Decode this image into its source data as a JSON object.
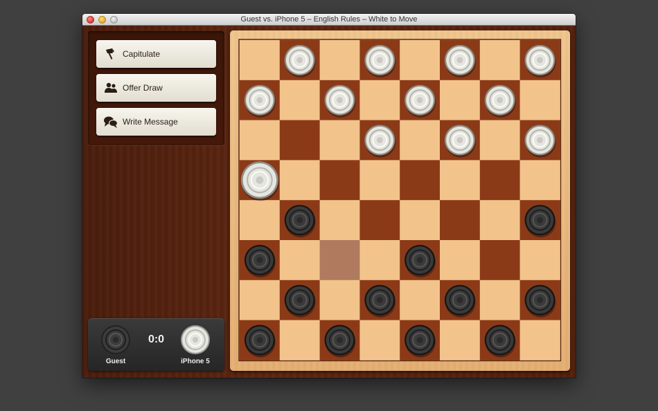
{
  "window": {
    "title": "Guest vs. iPhone 5 – English Rules – White to Move"
  },
  "actions": [
    {
      "label": "Capitulate",
      "icon": "flag-icon"
    },
    {
      "label": "Offer Draw",
      "icon": "handshake-icon"
    },
    {
      "label": "Write Message",
      "icon": "chat-bubbles-icon"
    }
  ],
  "score": {
    "value": "0:0",
    "left_player": {
      "name": "Guest",
      "piece": "dark"
    },
    "right_player": {
      "name": "iPhone 5",
      "piece": "light"
    }
  },
  "board": {
    "size": 8,
    "light_pieces": [
      [
        0,
        1
      ],
      [
        0,
        3
      ],
      [
        0,
        5
      ],
      [
        0,
        7
      ],
      [
        1,
        0
      ],
      [
        1,
        2
      ],
      [
        1,
        4
      ],
      [
        1,
        6
      ],
      [
        2,
        3
      ],
      [
        2,
        5
      ],
      [
        2,
        7
      ],
      [
        3,
        0
      ]
    ],
    "dark_pieces": [
      [
        4,
        1
      ],
      [
        4,
        7
      ],
      [
        5,
        0
      ],
      [
        5,
        4
      ],
      [
        6,
        1
      ],
      [
        6,
        3
      ],
      [
        6,
        5
      ],
      [
        6,
        7
      ],
      [
        7,
        0
      ],
      [
        7,
        2
      ],
      [
        7,
        4
      ],
      [
        7,
        6
      ]
    ],
    "lifted_piece": [
      3,
      0
    ],
    "highlight_square": [
      5,
      2
    ],
    "colors": {
      "light_square": "#f2c48c",
      "dark_square": "#8b3a18",
      "highlight": "#b07a5e",
      "light_piece": "#e6e6e0",
      "dark_piece": "#3a3a3a"
    }
  }
}
